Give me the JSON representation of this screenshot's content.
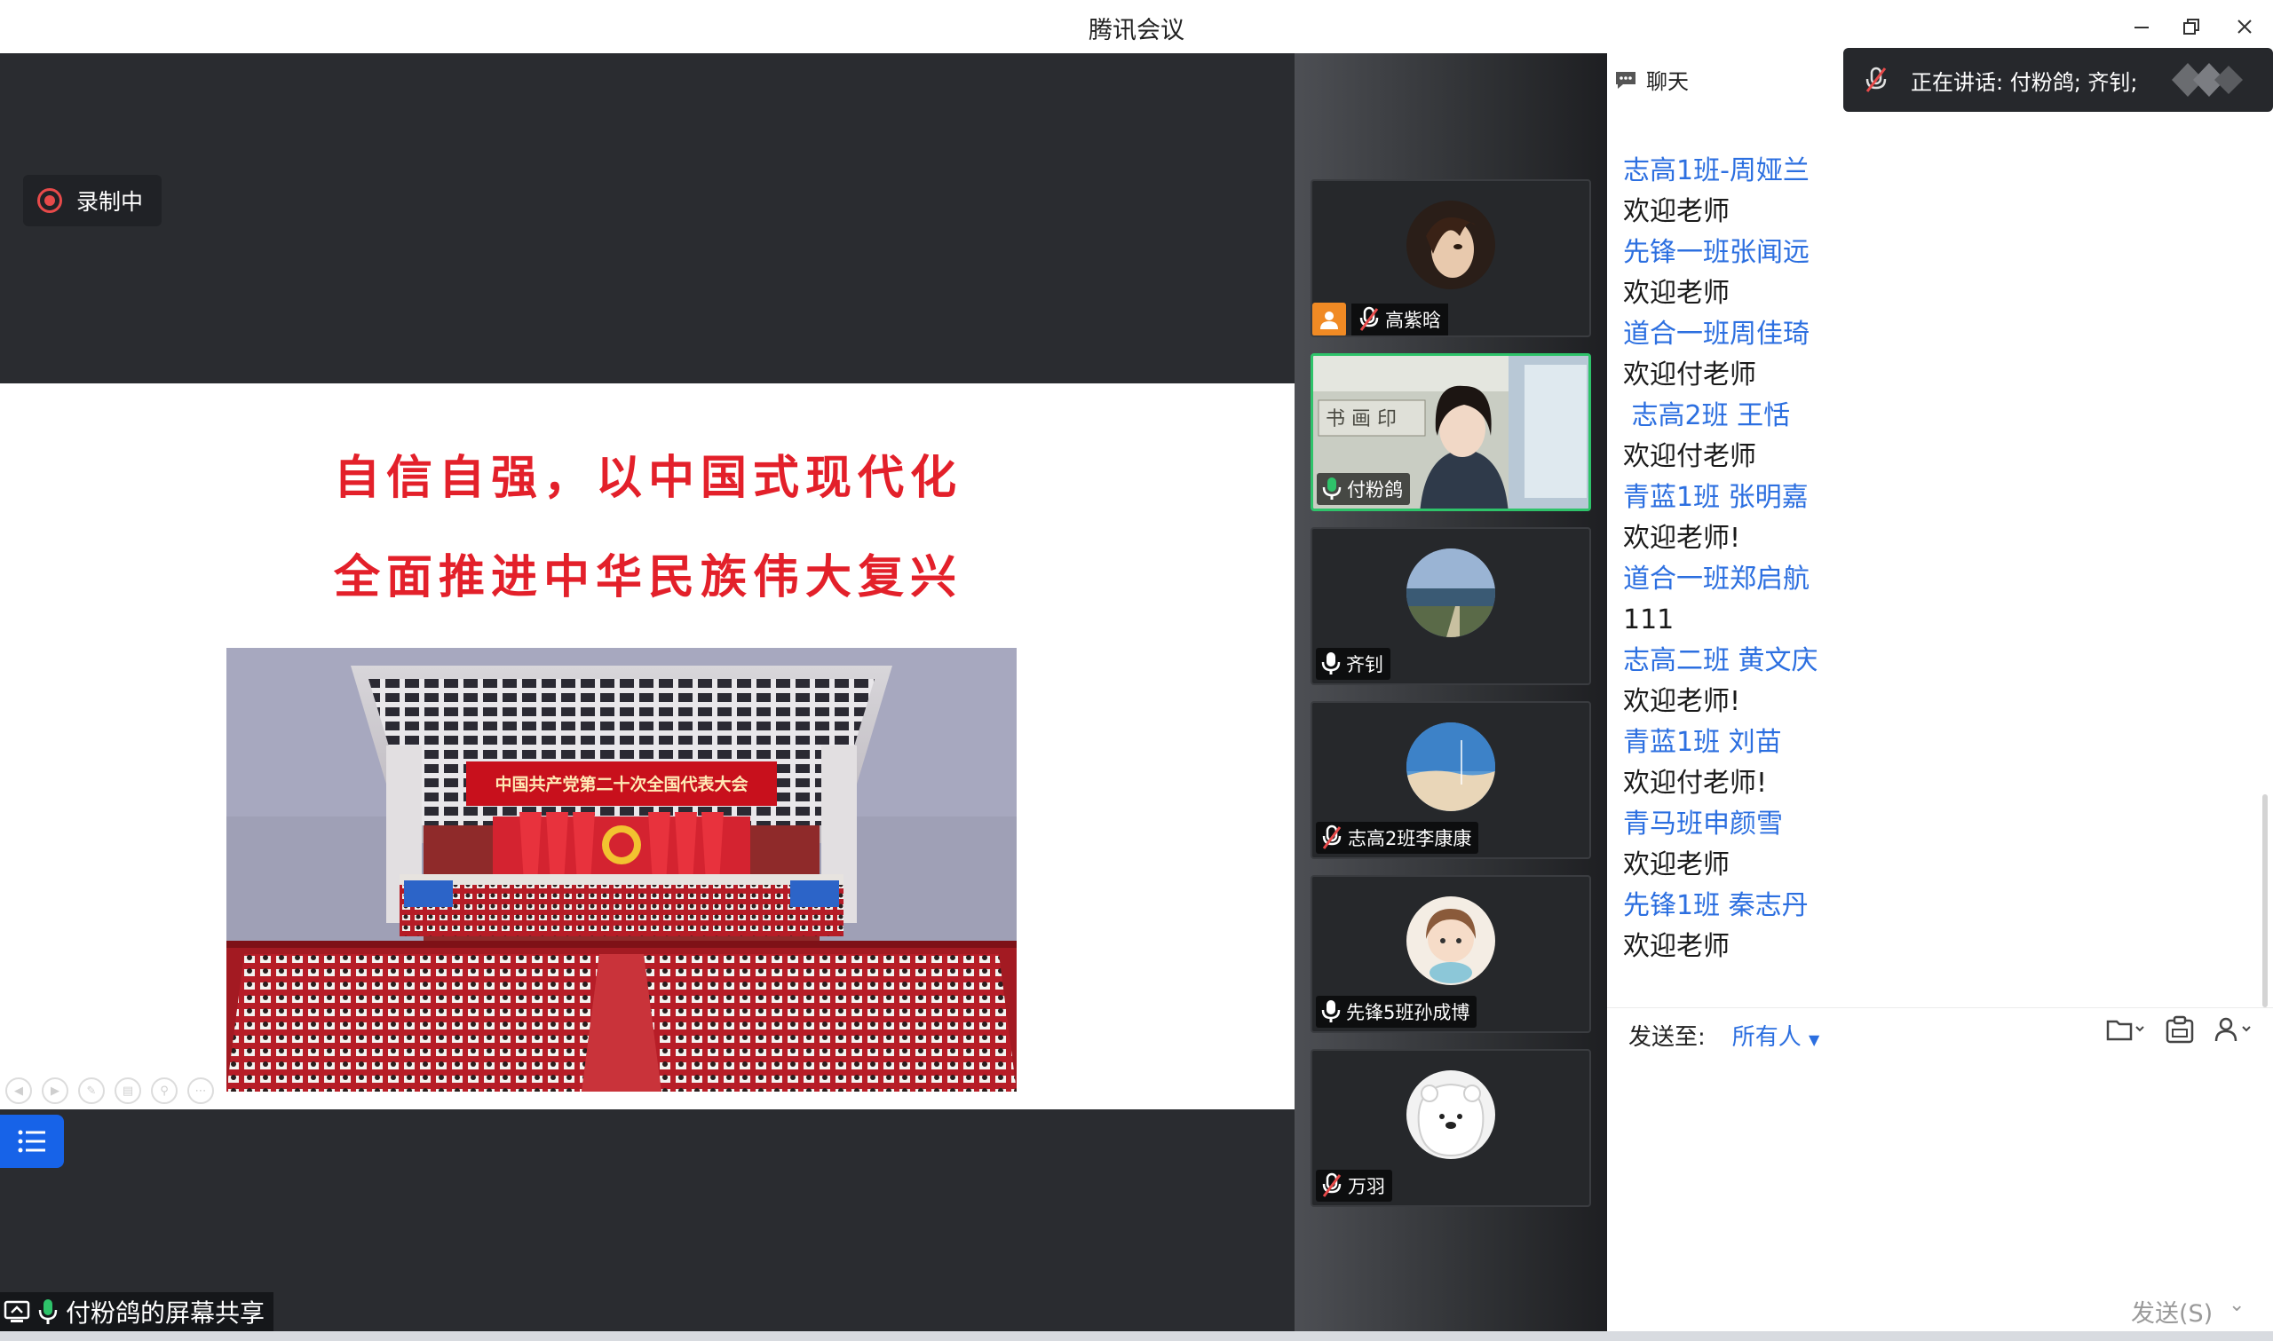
{
  "window": {
    "title": "腾讯会议"
  },
  "recording": {
    "label": "录制中"
  },
  "slide": {
    "line1": "自信自强，以中国式现代化",
    "line2": "全面推进中华民族伟大复兴",
    "banner_text": "中国共产党第二十次全国代表大会"
  },
  "share": {
    "label": "付粉鸽的屏幕共享"
  },
  "participants": [
    {
      "name": "高紫晗",
      "mic": "muted",
      "host": true
    },
    {
      "name": "付粉鸽",
      "mic": "speaking",
      "active": true
    },
    {
      "name": "齐钊",
      "mic": "on"
    },
    {
      "name": "志高2班李康康",
      "mic": "muted"
    },
    {
      "name": "先锋5班孙成博",
      "mic": "on"
    },
    {
      "name": "万羽",
      "mic": "muted"
    }
  ],
  "chat": {
    "title": "聊天",
    "speaking_banner": "正在讲话: 付粉鸽; 齐钊;",
    "messages": [
      {
        "type": "name",
        "text": "志高1班-周娅兰"
      },
      {
        "type": "text",
        "text": "欢迎老师"
      },
      {
        "type": "name",
        "text": "先锋一班张闻远"
      },
      {
        "type": "text",
        "text": "欢迎老师"
      },
      {
        "type": "name",
        "text": "道合一班周佳琦"
      },
      {
        "type": "text",
        "text": "欢迎付老师"
      },
      {
        "type": "name",
        "text": " 志高2班 王恬"
      },
      {
        "type": "text",
        "text": "欢迎付老师"
      },
      {
        "type": "name",
        "text": "青蓝1班 张明嘉"
      },
      {
        "type": "text",
        "text": "欢迎老师!"
      },
      {
        "type": "name",
        "text": "道合一班郑启航"
      },
      {
        "type": "text",
        "text": "111"
      },
      {
        "type": "name",
        "text": "志高二班 黄文庆"
      },
      {
        "type": "text",
        "text": "欢迎老师!"
      },
      {
        "type": "name",
        "text": "青蓝1班 刘苗"
      },
      {
        "type": "text",
        "text": "欢迎付老师!"
      },
      {
        "type": "name",
        "text": "青马班申颜雪"
      },
      {
        "type": "text",
        "text": "欢迎老师"
      },
      {
        "type": "name",
        "text": "先锋1班 秦志丹"
      },
      {
        "type": "text",
        "text": "欢迎老师"
      }
    ],
    "send_to_label": "发送至:",
    "send_to_value": "所有人",
    "send_button": "发送(S)"
  },
  "colors": {
    "accent": "#2c6fe0",
    "slide_red": "#e3202a",
    "speaking_green": "#2ec36a",
    "record_red": "#e74a4a"
  }
}
